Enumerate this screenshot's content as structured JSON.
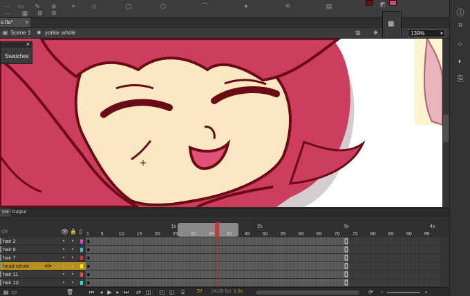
{
  "document": {
    "tab_label": "s.fla*",
    "tab_close": "×"
  },
  "breadcrumb": {
    "scene": "Scene 1",
    "symbol": "yorkie whole"
  },
  "zoom": {
    "value": "139%"
  },
  "swatches_panel": {
    "title": "Swatches",
    "close": "×"
  },
  "colors": {
    "hair": "#cc3d5e",
    "outline": "#6b0a14",
    "skin": "#fbe8c2",
    "selected_layer": "#b8901a",
    "playhead": "#cc2a2a"
  },
  "timeline": {
    "tabs": [
      "me",
      "Output"
    ],
    "off_label": "Off",
    "seconds": [
      "1s",
      "2s",
      "3s",
      "4s"
    ],
    "frame_ticks": [
      "1",
      "5",
      "10",
      "15",
      "20",
      "25",
      "30",
      "35",
      "40",
      "45",
      "50",
      "55",
      "60",
      "65",
      "70",
      "75",
      "80",
      "85",
      "90",
      "95"
    ],
    "layers": [
      {
        "name": "hair 2",
        "color": "#e040e0"
      },
      {
        "name": "hair 6",
        "color": "#3fbfbf"
      },
      {
        "name": "hair 7",
        "color": "#e03030"
      },
      {
        "name": "head whole",
        "color": "#e8e820",
        "selected": true
      },
      {
        "name": "hair 11",
        "color": "#e05050"
      },
      {
        "name": "hair 10",
        "color": "#30d0e0"
      }
    ],
    "current_frame": "37",
    "fps": "24.00 fps",
    "elapsed": "1.5s"
  }
}
